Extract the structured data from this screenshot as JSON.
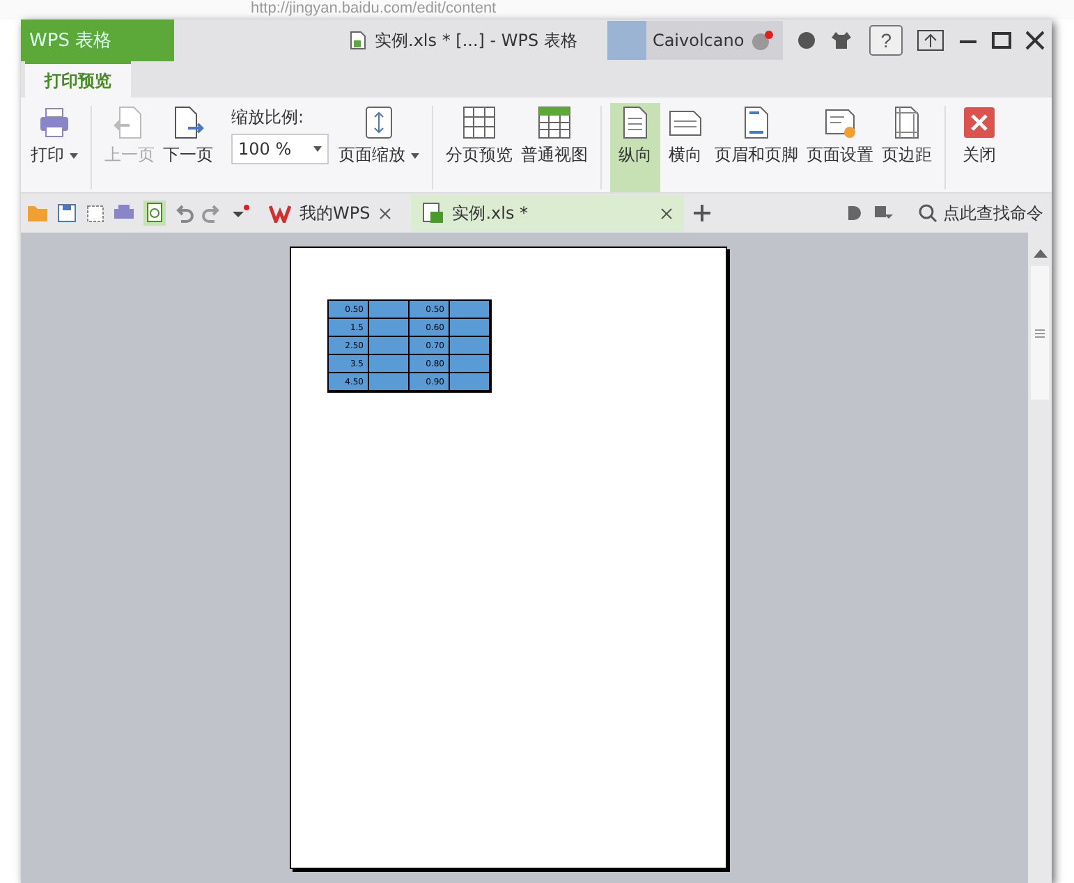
{
  "browser": {
    "url": "http://jingyan.baidu.com/edit/content"
  },
  "window": {
    "app_button": "WPS 表格",
    "title": "实例.xls * [...] - WPS 表格",
    "user": "Caivolcano",
    "help": "?"
  },
  "ribbon_tabs": [
    {
      "label": "打印预览",
      "selected": true
    }
  ],
  "ribbon": [
    {
      "kind": "tool",
      "label": "打印",
      "dropdown": true,
      "disabled": false,
      "selected": false
    },
    {
      "kind": "separator"
    },
    {
      "kind": "tool",
      "label": "上一页",
      "dropdown": false,
      "disabled": true,
      "selected": false
    },
    {
      "kind": "tool",
      "label": "下一页",
      "dropdown": false,
      "disabled": false,
      "selected": false
    },
    {
      "kind": "zoom",
      "label": "缩放比例:",
      "value": "100 %"
    },
    {
      "kind": "tool",
      "label": "页面缩放",
      "dropdown": true,
      "disabled": false,
      "selected": false
    },
    {
      "kind": "separator"
    },
    {
      "kind": "tool",
      "label": "分页预览",
      "dropdown": false,
      "disabled": false,
      "selected": false
    },
    {
      "kind": "tool",
      "label": "普通视图",
      "dropdown": false,
      "disabled": false,
      "selected": false
    },
    {
      "kind": "separator"
    },
    {
      "kind": "tool",
      "label": "纵向",
      "dropdown": false,
      "disabled": false,
      "selected": true
    },
    {
      "kind": "tool",
      "label": "横向",
      "dropdown": false,
      "disabled": false,
      "selected": false
    },
    {
      "kind": "tool",
      "label": "页眉和页脚",
      "dropdown": false,
      "disabled": false,
      "selected": false
    },
    {
      "kind": "tool",
      "label": "页面设置",
      "dropdown": false,
      "disabled": false,
      "selected": false
    },
    {
      "kind": "tool",
      "label": "页边距",
      "dropdown": false,
      "disabled": false,
      "selected": false
    },
    {
      "kind": "separator"
    },
    {
      "kind": "tool",
      "label": "关闭",
      "dropdown": false,
      "disabled": false,
      "selected": false
    }
  ],
  "doc_tabs": [
    {
      "label": "我的WPS",
      "selected": false
    },
    {
      "label": "实例.xls *",
      "selected": true
    }
  ],
  "command_search": "点此查找命令",
  "sheet": {
    "rows": [
      {
        "column_1": "0.50",
        "column_3": "0.50"
      },
      {
        "column_1": "1.5",
        "column_3": "0.60"
      },
      {
        "column_1": "2.50",
        "column_3": "0.70"
      },
      {
        "column_1": "3.5",
        "column_3": "0.80"
      },
      {
        "column_1": "4.50",
        "column_3": "0.90"
      }
    ]
  }
}
